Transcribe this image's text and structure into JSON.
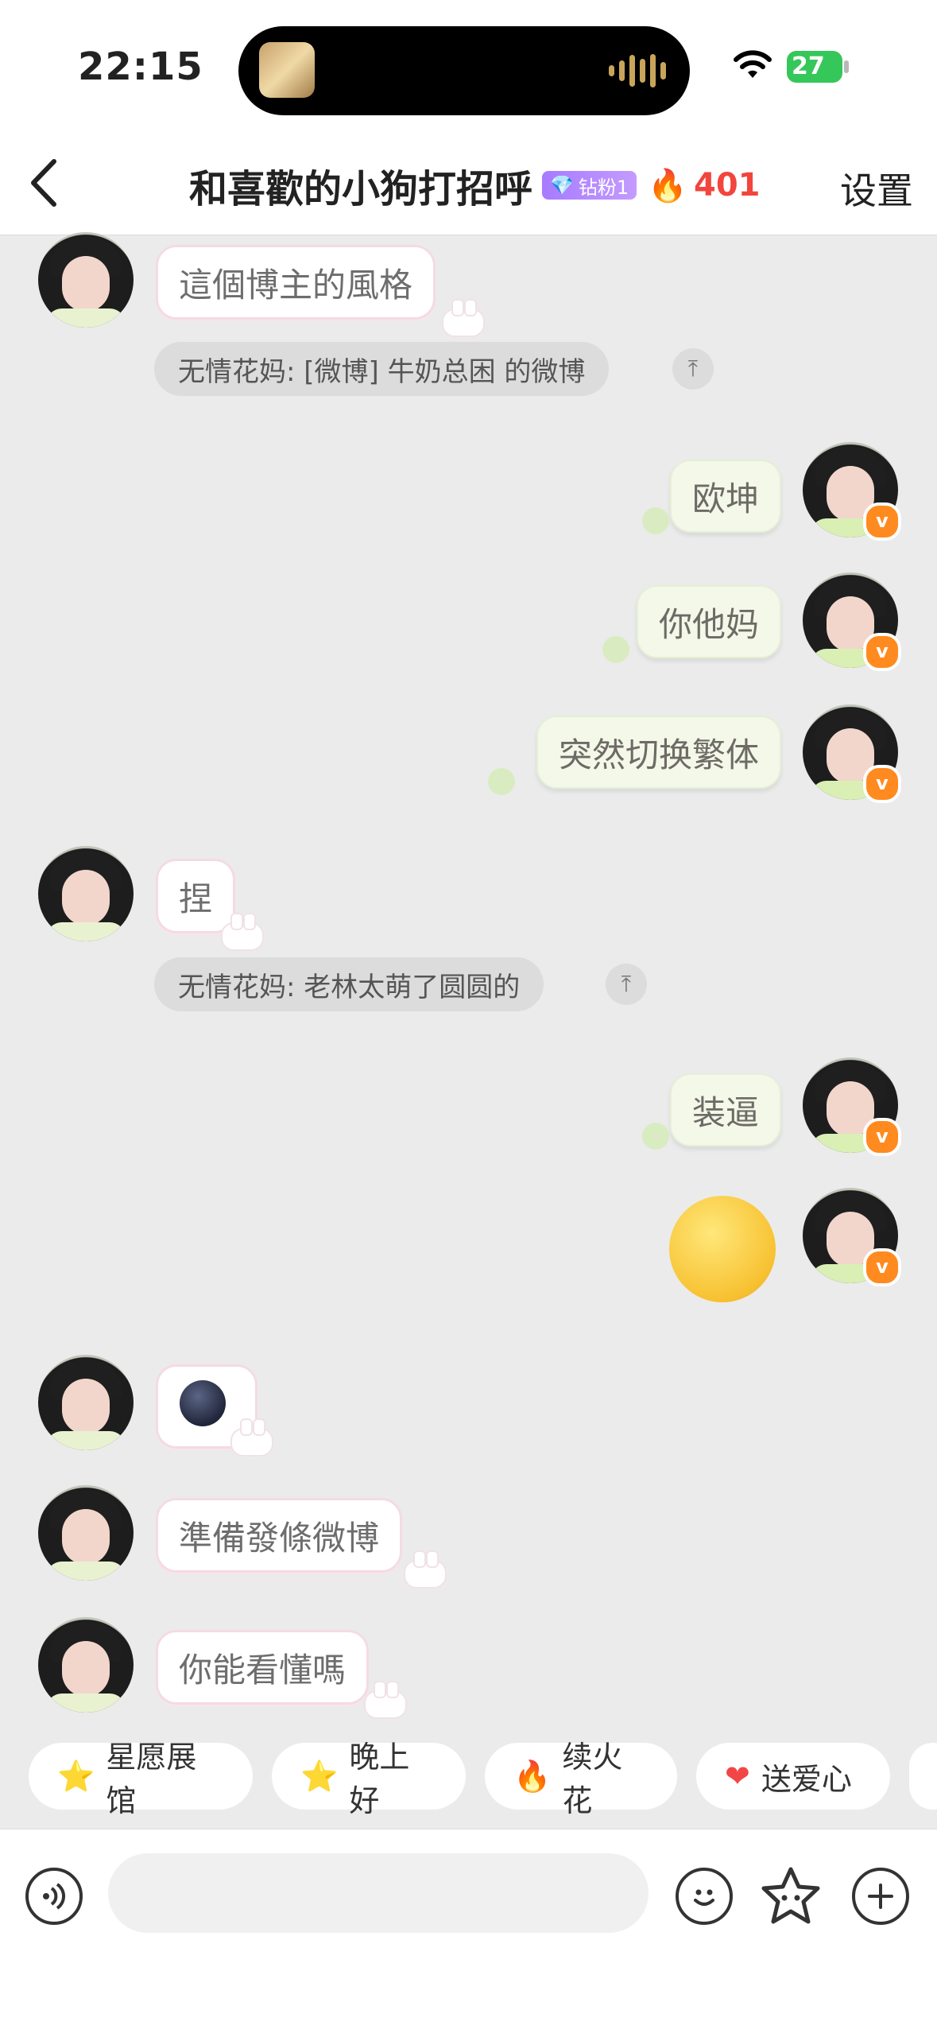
{
  "status": {
    "time": "22:15",
    "battery": "27"
  },
  "header": {
    "back_label": "<",
    "title": "和喜歡的小狗打招呼",
    "badge": "钻粉1",
    "fire_count": "401",
    "settings": "设置"
  },
  "messages": {
    "m1": "這個博主的風格",
    "q1": "无情花妈: [微博] 牛奶总困 的微博",
    "m2": "欧坤",
    "m3": "你他妈",
    "m4": "突然切换繁体",
    "m5": "捏",
    "q2": "无情花妈: 老林太萌了圆圆的",
    "m6": "装逼",
    "m9": "準備發條微博",
    "m10": "你能看懂嗎"
  },
  "quote_jump": "⤒",
  "quick_actions": [
    {
      "label": "星愿展馆",
      "icon": "⭐"
    },
    {
      "label": "晚上好",
      "icon": "⭐"
    },
    {
      "label": "续火花",
      "icon": "🔥"
    },
    {
      "label": "送爱心",
      "icon": "❤"
    }
  ],
  "input": {
    "placeholder": ""
  },
  "verified_mark": "v"
}
